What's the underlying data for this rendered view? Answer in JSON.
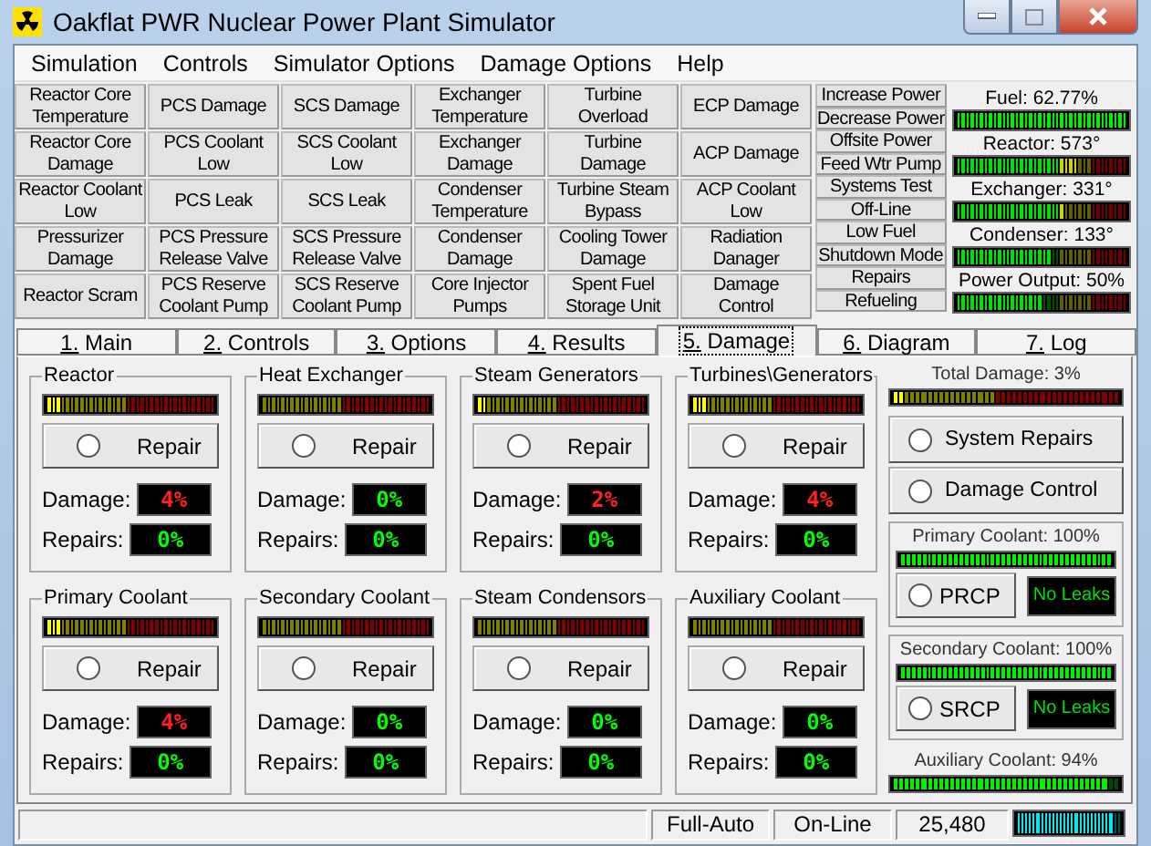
{
  "window": {
    "title": "Oakflat PWR Nuclear Power Plant Simulator"
  },
  "menu": [
    "Simulation",
    "Controls",
    "Simulator Options",
    "Damage Options",
    "Help"
  ],
  "annunciators": [
    [
      "Reactor Core Temperature",
      "Reactor Core Damage",
      "Reactor Coolant Low",
      "Pressurizer Damage",
      "Reactor Scram"
    ],
    [
      "PCS Damage",
      "PCS Coolant Low",
      "PCS Leak",
      "PCS Pressure Release Valve",
      "PCS Reserve Coolant Pump"
    ],
    [
      "SCS Damage",
      "SCS Coolant Low",
      "SCS Leak",
      "SCS Pressure Release Valve",
      "SCS Reserve Coolant Pump"
    ],
    [
      "Exchanger Temperature",
      "Exchanger Damage",
      "Condenser Temperature",
      "Condenser Damage",
      "Core Injector Pumps"
    ],
    [
      "Turbine Overload",
      "Turbine Damage",
      "Turbine Steam Bypass",
      "Cooling Tower Damage",
      "Spent Fuel Storage Unit"
    ],
    [
      "ECP Damage",
      "ACP Damage",
      "ACP Coolant Low",
      "Radiation Danager",
      "Damage Control"
    ]
  ],
  "status_lights": [
    "Increase Power",
    "Decrease Power",
    "Offsite Power",
    "Feed Wtr Pump",
    "Systems Test",
    "Off-Line",
    "Low Fuel",
    "Shutdown Mode",
    "Repairs",
    "Refueling"
  ],
  "gauges": [
    {
      "label": "Fuel: 62.77%",
      "kind": "fill",
      "level": 1
    },
    {
      "label": "Reactor: 573°",
      "kind": "scale",
      "level": 0.72
    },
    {
      "label": "Exchanger: 331°",
      "kind": "scale",
      "level": 0.62
    },
    {
      "label": "Condenser: 133°",
      "kind": "scale",
      "level": 0.55
    },
    {
      "label": "Power Output: 50%",
      "kind": "scale",
      "level": 0.5
    }
  ],
  "tabs": [
    {
      "label": "1. Main",
      "selected": false
    },
    {
      "label": "2. Controls",
      "selected": false
    },
    {
      "label": "3. Options",
      "selected": false
    },
    {
      "label": "4. Results",
      "selected": false
    },
    {
      "label": "5. Damage",
      "selected": true
    },
    {
      "label": "6. Diagram",
      "selected": false
    },
    {
      "label": "7. Log",
      "selected": false
    }
  ],
  "systems": [
    {
      "title": "Reactor",
      "level": 0.08,
      "button": "Repair",
      "on": false,
      "damage_label": "Damage:",
      "damage": "4%",
      "damage_alarm": true,
      "repairs_label": "Repairs:",
      "repairs": "0%"
    },
    {
      "title": "Heat Exchanger",
      "level": 0,
      "button": "Repair",
      "on": false,
      "damage_label": "Damage:",
      "damage": "0%",
      "damage_alarm": false,
      "repairs_label": "Repairs:",
      "repairs": "0%"
    },
    {
      "title": "Steam Generators",
      "level": 0.06,
      "button": "Repair",
      "on": false,
      "damage_label": "Damage:",
      "damage": "2%",
      "damage_alarm": true,
      "repairs_label": "Repairs:",
      "repairs": "0%"
    },
    {
      "title": "Turbines\\Generators",
      "level": 0.08,
      "button": "Repair",
      "on": false,
      "damage_label": "Damage:",
      "damage": "4%",
      "damage_alarm": true,
      "repairs_label": "Repairs:",
      "repairs": "0%"
    },
    {
      "title": "Primary Coolant",
      "level": 0.08,
      "button": "Repair",
      "on": false,
      "damage_label": "Damage:",
      "damage": "4%",
      "damage_alarm": true,
      "repairs_label": "Repairs:",
      "repairs": "0%"
    },
    {
      "title": "Secondary Coolant",
      "level": 0,
      "button": "Repair",
      "on": false,
      "damage_label": "Damage:",
      "damage": "0%",
      "damage_alarm": false,
      "repairs_label": "Repairs:",
      "repairs": "0%"
    },
    {
      "title": "Steam Condensors",
      "level": 0,
      "button": "Repair",
      "on": false,
      "damage_label": "Damage:",
      "damage": "0%",
      "damage_alarm": false,
      "repairs_label": "Repairs:",
      "repairs": "0%"
    },
    {
      "title": "Auxiliary Coolant",
      "level": 0,
      "button": "Repair",
      "on": false,
      "damage_label": "Damage:",
      "damage": "0%",
      "damage_alarm": false,
      "repairs_label": "Repairs:",
      "repairs": "0%"
    }
  ],
  "total": {
    "label": "Total Damage: 3%",
    "level": 0.06,
    "buttons": [
      {
        "label": "System Repairs",
        "on": false
      },
      {
        "label": "Damage Control",
        "on": false
      }
    ]
  },
  "coolant_pumps": [
    {
      "label": "Primary Coolant: 100%",
      "level": 1,
      "button": "PRCP",
      "on": false,
      "status": "No Leaks"
    },
    {
      "label": "Secondary Coolant: 100%",
      "level": 1,
      "button": "SRCP",
      "on": false,
      "status": "No Leaks"
    }
  ],
  "auxiliary": {
    "label": "Auxiliary Coolant: 94%",
    "level": 0.94
  },
  "status_bar": {
    "mode": "Full-Auto",
    "state": "On-Line",
    "count": "25,480",
    "level": 0.92
  }
}
